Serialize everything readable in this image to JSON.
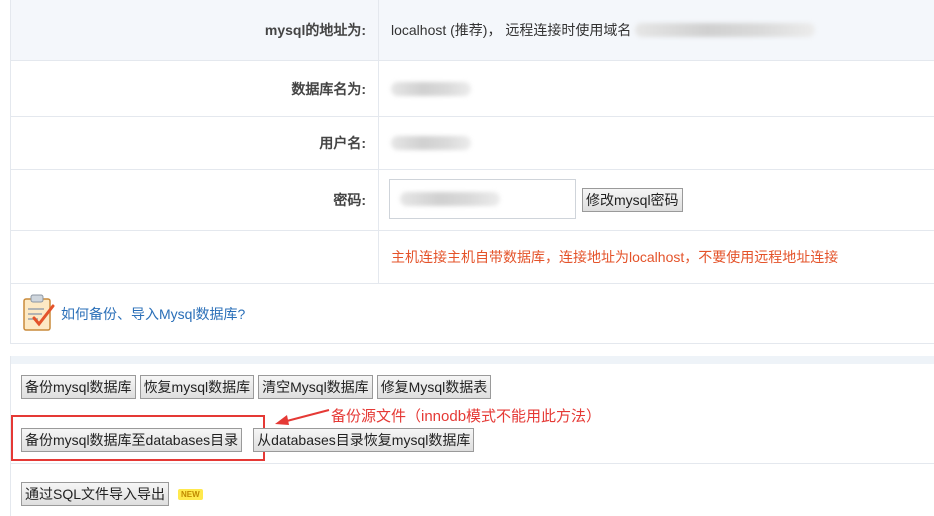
{
  "db_info": {
    "address_label": "mysql的地址为:",
    "address_value": "localhost (推荐)，   远程连接时使用域名",
    "dbname_label": "数据库名为:",
    "username_label": "用户名:",
    "password_label": "密码:",
    "change_password_button": "修改mysql密码",
    "warning": "主机连接主机自带数据库，连接地址为localhost，不要使用远程地址连接"
  },
  "help": {
    "link": "如何备份、导入Mysql数据库?"
  },
  "actions": {
    "row1": [
      "备份mysql数据库",
      "恢复mysql数据库",
      "清空Mysql数据库",
      "修复Mysql数据表"
    ],
    "row2": [
      "备份mysql数据库至databases目录",
      "从databases目录恢复mysql数据库"
    ],
    "row3_button": "通过SQL文件导入导出",
    "new_badge": "NEW"
  },
  "annotation": {
    "text": "备份源文件（innodb模式不能用此方法）",
    "color": "#e53935"
  },
  "colors": {
    "warning": "#e4532a",
    "link": "#2a6fb8",
    "label_bg": "#f4f7fb"
  }
}
